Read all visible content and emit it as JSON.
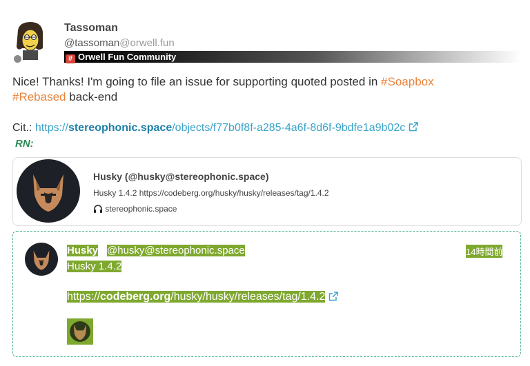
{
  "author": {
    "display_name": "Tassoman",
    "handle_user": "@tassoman",
    "handle_host": "@orwell.fun",
    "community": "Orwell Fun Community"
  },
  "post": {
    "text_before": "Nice! Thanks! I'm going to file an issue for supporting quoted posted in ",
    "tag1": "#Soapbox",
    "tag2": "#Rebased",
    "text_after": " back-end",
    "cite_label": "Cit.:",
    "cite_url_scheme": "https://",
    "cite_url_host": "stereophonic.space",
    "cite_url_path": "/objects/f77b0f8f-a285-4a6f-8d6f-9bdfe1a9b02c",
    "rn_label": "RN:"
  },
  "card": {
    "title": "Husky (@husky@stereophonic.space)",
    "description": "Husky 1.4.2 https://codeberg.org/husky/husky/releases/tag/1.4.2",
    "host": "stereophonic.space",
    "host_icon": "headphones-icon"
  },
  "quote": {
    "name": "Husky",
    "handle_user": "@husky",
    "handle_host": "@stereophonic.space",
    "time": "14時間前",
    "body": "Husky 1.4.2",
    "link_scheme": "https://",
    "link_host": "codeberg.org",
    "link_path": "/husky/husky/releases/tag/1.4.2"
  },
  "colors": {
    "tag": "#e8833a",
    "link": "#3aa3c8",
    "rn": "#2c8b57",
    "highlight": "#7fa82f",
    "quote_border": "#4bb09a"
  }
}
